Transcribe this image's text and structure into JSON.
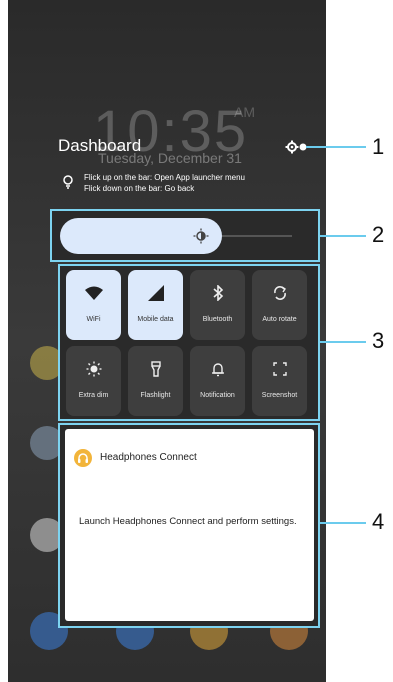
{
  "background": {
    "clock": "10:35",
    "ampm": "AM",
    "date": "Tuesday, December 31"
  },
  "dashboard": {
    "title": "Dashboard",
    "hints": [
      "Flick up on the bar: Open App launcher menu",
      "Flick down on the bar: Go back"
    ]
  },
  "brightness": {
    "level": 0.7
  },
  "tiles": [
    {
      "label": "WiFi",
      "icon": "wifi-icon",
      "active": true
    },
    {
      "label": "Mobile data",
      "icon": "signal-icon",
      "active": true
    },
    {
      "label": "Bluetooth",
      "icon": "bluetooth-icon",
      "active": false
    },
    {
      "label": "Auto rotate",
      "icon": "rotate-icon",
      "active": false
    },
    {
      "label": "Extra dim",
      "icon": "dim-icon",
      "active": false
    },
    {
      "label": "Flashlight",
      "icon": "flashlight-icon",
      "active": false
    },
    {
      "label": "Notification",
      "icon": "bell-icon",
      "active": false
    },
    {
      "label": "Screenshot",
      "icon": "screenshot-icon",
      "active": false
    }
  ],
  "card": {
    "title": "Headphones Connect",
    "text": "Launch Headphones Connect and perform settings."
  },
  "callouts": [
    "1",
    "2",
    "3",
    "4"
  ],
  "colors": {
    "highlight": "#7dd3f0",
    "tile_on": "#dce9fb",
    "tile_off": "#3e3e3e"
  }
}
